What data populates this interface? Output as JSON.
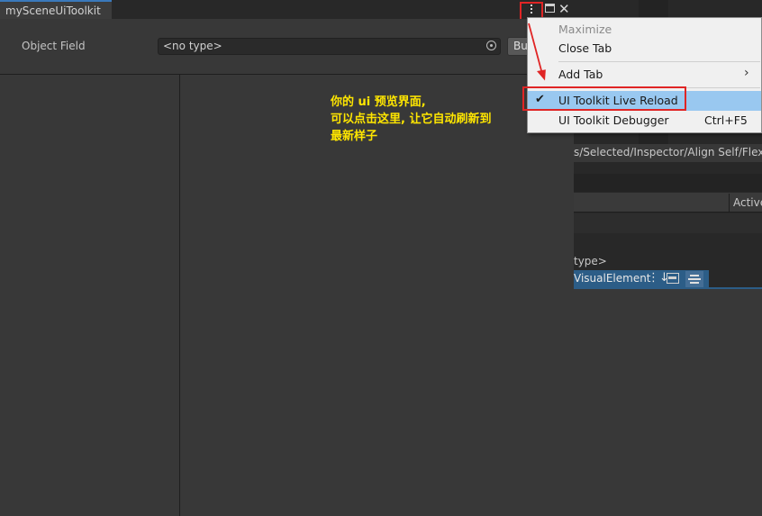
{
  "window": {
    "tab_title": "mySceneUiToolkit"
  },
  "toolbar": {
    "field_label": "Object Field",
    "field_value": "<no type>",
    "button_label": "Butt"
  },
  "annotation": {
    "lines": [
      "你的 ui 预览界面,",
      "可以点击这里, 让它自动刷新到",
      "最新样子"
    ],
    "color": "#ffe600"
  },
  "menu": {
    "items": [
      {
        "label": "Maximize",
        "enabled": false
      },
      {
        "label": "Close Tab",
        "enabled": true
      },
      {
        "label": "Add Tab",
        "enabled": true,
        "submenu": true
      },
      {
        "label": "UI Toolkit Live Reload",
        "enabled": true,
        "checked": true
      },
      {
        "label": "UI Toolkit Debugger",
        "enabled": true,
        "shortcut": "Ctrl+F5"
      }
    ]
  },
  "background_panel": {
    "path": "s/Selected/Inspector/Align Self/Flex",
    "column_active": "Active",
    "type_text": "type>",
    "element_label": "VisualElement"
  },
  "icons": {
    "more": "more-vertical-icon",
    "maximize": "maximize-icon",
    "close": "close-icon",
    "object_picker": "object-picker-icon",
    "check": "check-icon",
    "submenu": "chevron-right-icon"
  },
  "colors": {
    "accent_blue": "#3a79bb",
    "highlight_red": "#e02525",
    "menu_selected": "#99c8f0"
  }
}
